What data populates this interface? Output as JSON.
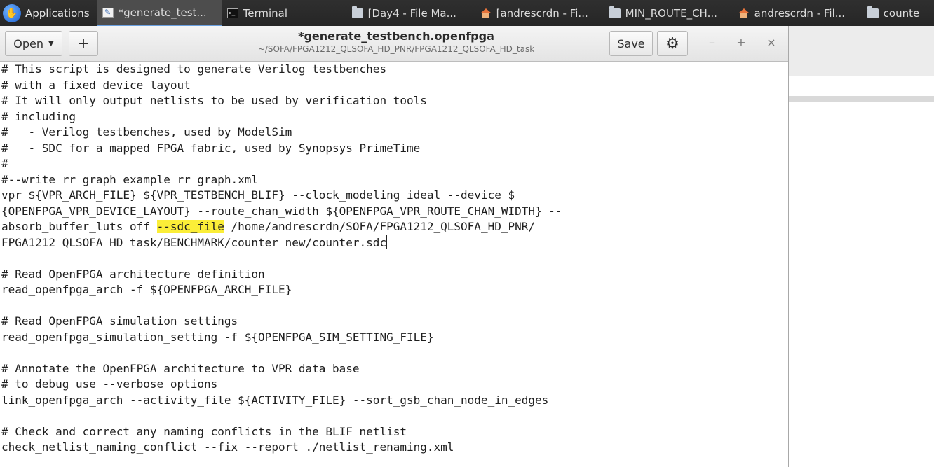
{
  "taskbar": {
    "apps_label": "Applications",
    "tasks": [
      {
        "label": "*generate_test...",
        "icon": "text-editor-icon"
      },
      {
        "label": "Terminal",
        "icon": "terminal-icon"
      },
      {
        "label": "[Day4 - File Ma...",
        "icon": "folder-icon"
      },
      {
        "label": "[andrescrdn - Fi...",
        "icon": "home-folder-icon"
      },
      {
        "label": "MIN_ROUTE_CH...",
        "icon": "folder-icon"
      },
      {
        "label": "andrescrdn - Fil...",
        "icon": "home-folder-icon"
      },
      {
        "label": "counte",
        "icon": "folder-icon"
      }
    ]
  },
  "editor": {
    "open_label": "Open",
    "new_label": "+",
    "title": "*generate_testbench.openfpga",
    "path": "~/SOFA/FPGA1212_QLSOFA_HD_PNR/FPGA1212_QLSOFA_HD_task",
    "save_label": "Save",
    "minimize": "–",
    "maximize": "+",
    "close": "×",
    "search_highlight": "--sdc_file",
    "highlight_color": "#fbee38",
    "lines": [
      "# This script is designed to generate Verilog testbenches",
      "# with a fixed device layout",
      "# It will only output netlists to be used by verification tools",
      "# including",
      "#   - Verilog testbenches, used by ModelSim",
      "#   - SDC for a mapped FPGA fabric, used by Synopsys PrimeTime",
      "#",
      "#--write_rr_graph example_rr_graph.xml",
      "vpr ${VPR_ARCH_FILE} ${VPR_TESTBENCH_BLIF} --clock_modeling ideal --device $",
      "{OPENFPGA_VPR_DEVICE_LAYOUT} --route_chan_width ${OPENFPGA_VPR_ROUTE_CHAN_WIDTH} --",
      "absorb_buffer_luts off --sdc_file /home/andrescrdn/SOFA/FPGA1212_QLSOFA_HD_PNR/",
      "FPGA1212_QLSOFA_HD_task/BENCHMARK/counter_new/counter.sdc",
      "",
      "# Read OpenFPGA architecture definition",
      "read_openfpga_arch -f ${OPENFPGA_ARCH_FILE}",
      "",
      "# Read OpenFPGA simulation settings",
      "read_openfpga_simulation_setting -f ${OPENFPGA_SIM_SETTING_FILE}",
      "",
      "# Annotate the OpenFPGA architecture to VPR data base",
      "# to debug use --verbose options",
      "link_openfpga_arch --activity_file ${ACTIVITY_FILE} --sort_gsb_chan_node_in_edges",
      "",
      "# Check and correct any naming conflicts in the BLIF netlist",
      "check_netlist_naming_conflict --fix --report ./netlist_renaming.xml"
    ]
  }
}
